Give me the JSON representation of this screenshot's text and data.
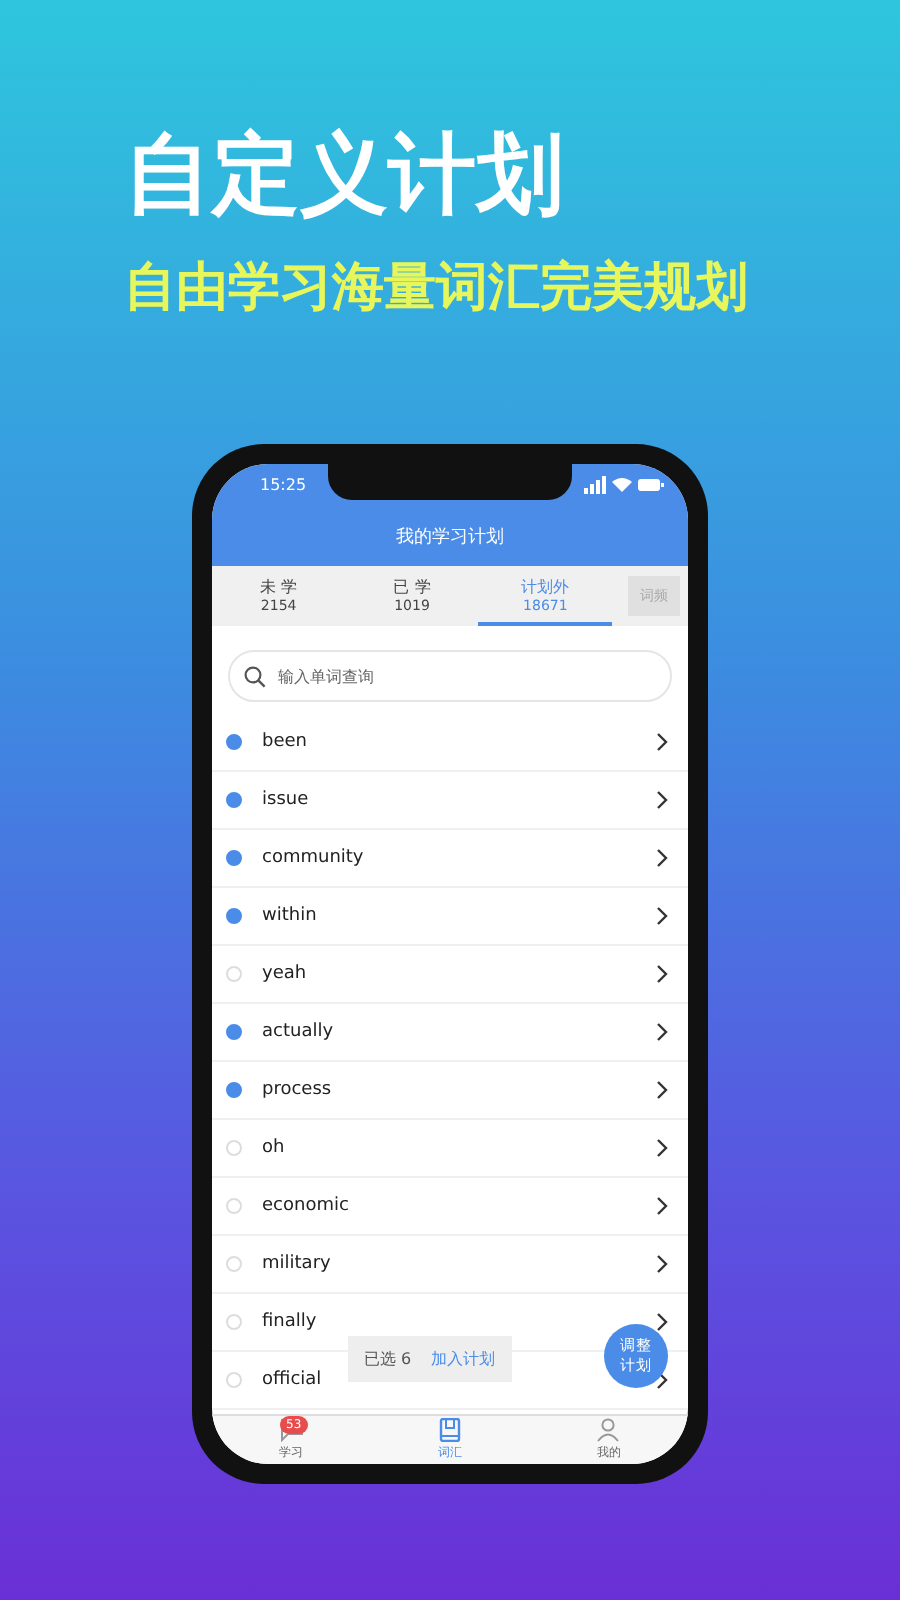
{
  "headline": "自定义计划",
  "subheadline": "自由学习海量词汇完美规划",
  "status_bar": {
    "time": "15:25"
  },
  "header": {
    "title": "我的学习计划"
  },
  "tabs": [
    {
      "label": "未 学",
      "count": "2154",
      "selected": false
    },
    {
      "label": "已 学",
      "count": "1019",
      "selected": false
    },
    {
      "label": "计划外",
      "count": "18671",
      "selected": true
    }
  ],
  "sort_button": "词频",
  "search": {
    "placeholder": "输入单词查询"
  },
  "words": [
    {
      "word": "been",
      "checked": true
    },
    {
      "word": "issue",
      "checked": true
    },
    {
      "word": "community",
      "checked": true
    },
    {
      "word": "within",
      "checked": true
    },
    {
      "word": "yeah",
      "checked": false
    },
    {
      "word": "actually",
      "checked": true
    },
    {
      "word": "process",
      "checked": true
    },
    {
      "word": "oh",
      "checked": false
    },
    {
      "word": "economic",
      "checked": false
    },
    {
      "word": "military",
      "checked": false
    },
    {
      "word": "finally",
      "checked": false
    },
    {
      "word": "official",
      "checked": false
    }
  ],
  "selection_bar": {
    "count": "已选 6",
    "action": "加入计划"
  },
  "fab": {
    "label": "调整计划"
  },
  "bottom_nav": [
    {
      "kind": "study",
      "label": "学习",
      "badge": "53",
      "selected": false
    },
    {
      "kind": "vocabulary",
      "label": "词汇",
      "selected": true
    },
    {
      "kind": "profile",
      "label": "我的",
      "selected": false
    }
  ]
}
